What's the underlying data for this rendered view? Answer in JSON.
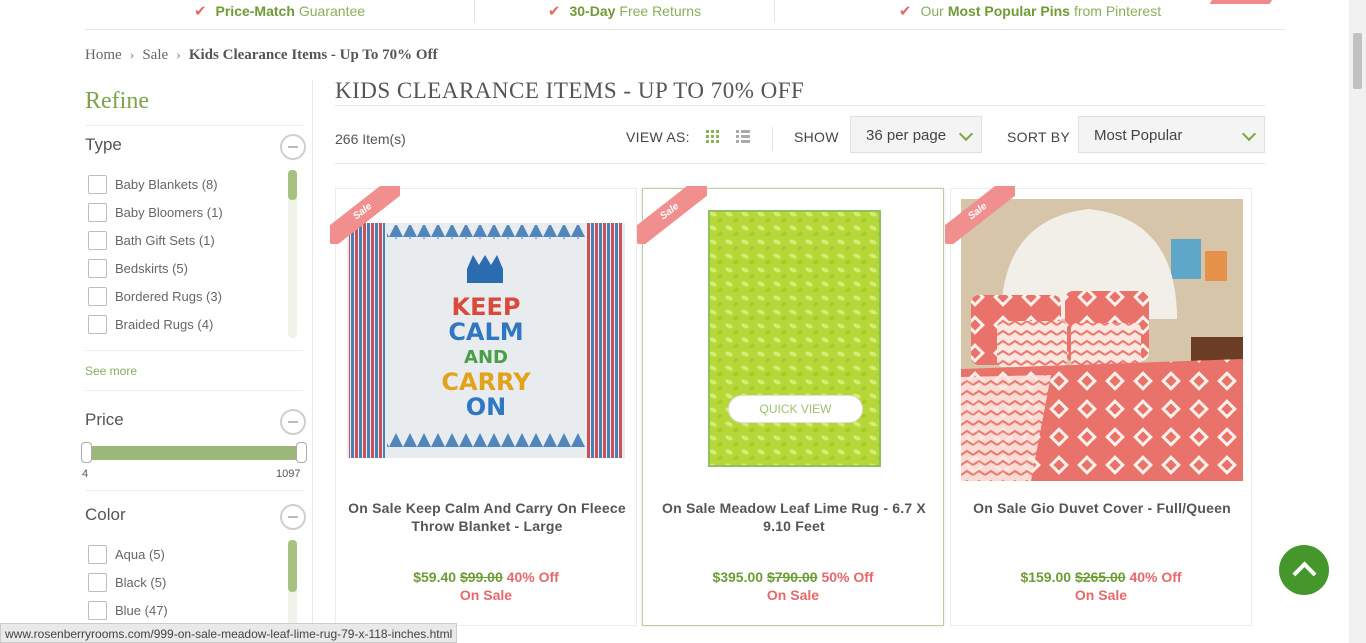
{
  "promo": {
    "items": [
      {
        "bold": "Price-Match",
        "rest": "Guarantee"
      },
      {
        "bold": "30-Day",
        "rest": "Free Returns"
      },
      {
        "prefix": "Our",
        "bold": "Most Popular Pins",
        "rest": "from Pinterest"
      }
    ]
  },
  "breadcrumb": {
    "home": "Home",
    "sale": "Sale",
    "current": "Kids Clearance Items - Up To 70% Off"
  },
  "sidebar": {
    "refine": "Refine",
    "type": {
      "title": "Type",
      "options": [
        "Baby Blankets (8)",
        "Baby Bloomers (1)",
        "Bath Gift Sets (1)",
        "Bedskirts (5)",
        "Bordered Rugs (3)",
        "Braided Rugs (4)"
      ],
      "see_more": "See more"
    },
    "price": {
      "title": "Price",
      "min": "4",
      "max": "1097"
    },
    "color": {
      "title": "Color",
      "options": [
        "Aqua (5)",
        "Black (5)",
        "Blue (47)"
      ]
    }
  },
  "main": {
    "title": "KIDS CLEARANCE ITEMS - UP TO 70% OFF",
    "item_count": "266 Item(s)",
    "view_as": "VIEW AS:",
    "show_label": "SHOW",
    "show_value": "36 per page",
    "sort_label": "SORT BY",
    "sort_value": "Most Popular"
  },
  "products": [
    {
      "sale_tag": "Sale",
      "title": "On Sale Keep Calm And Carry On Fleece Throw Blanket - Large",
      "price": "$59.40",
      "was": "$99.00",
      "off": "40% Off",
      "on_sale": "On Sale",
      "image_text": [
        "KEEP",
        "CALM",
        "AND",
        "CARRY",
        "ON"
      ]
    },
    {
      "sale_tag": "Sale",
      "title": "On Sale Meadow Leaf Lime Rug - 6.7 X 9.10 Feet",
      "price": "$395.00",
      "was": "$790.00",
      "off": "50% Off",
      "on_sale": "On Sale",
      "quick_view": "QUICK VIEW"
    },
    {
      "sale_tag": "Sale",
      "title": "On Sale Gio Duvet Cover - Full/Queen",
      "price": "$159.00",
      "was": "$265.00",
      "off": "40% Off",
      "on_sale": "On Sale"
    }
  ],
  "status_url": "www.rosenberryrooms.com/999-on-sale-meadow-leaf-lime-rug-79-x-118-inches.html",
  "colors": {
    "accent_green": "#7fa24a",
    "sale_pink": "#f18f8e",
    "back_to_top": "#46972b"
  }
}
